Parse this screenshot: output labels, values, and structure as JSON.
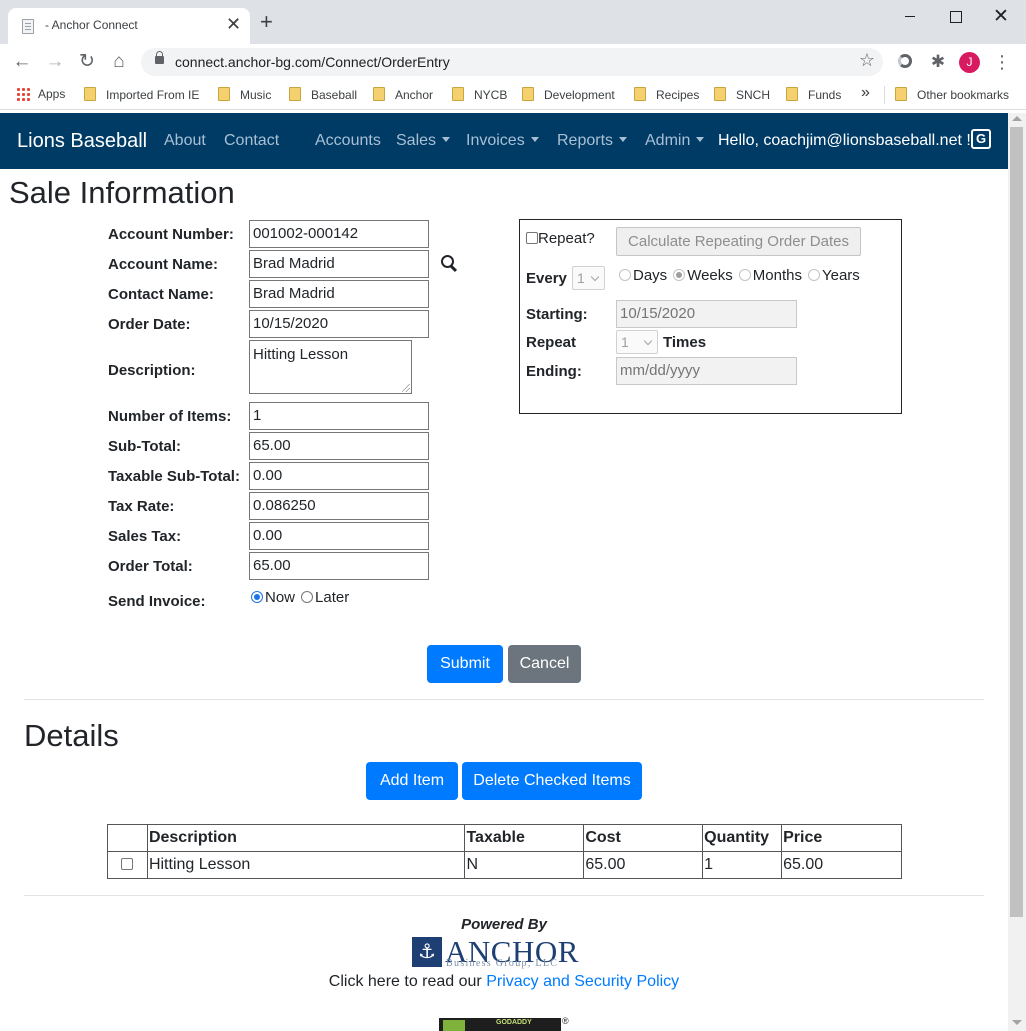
{
  "browser": {
    "tab_title": "- Anchor Connect",
    "url": "connect.anchor-bg.com/Connect/OrderEntry",
    "avatar_initial": "J",
    "bookmarks": [
      "Apps",
      "Imported From IE",
      "Music",
      "Baseball",
      "Anchor",
      "NYCB",
      "Development",
      "Recipes",
      "SNCH",
      "Funds"
    ],
    "other_bookmarks": "Other bookmarks"
  },
  "nav": {
    "brand": "Lions Baseball",
    "links": [
      "About",
      "Contact"
    ],
    "menus": [
      "Accounts",
      "Sales",
      "Invoices",
      "Reports",
      "Admin"
    ],
    "greeting": "Hello, coachjim@lionsbaseball.net !"
  },
  "sale": {
    "title": "Sale Information",
    "labels": {
      "account_number": "Account Number:",
      "account_name": "Account Name:",
      "contact_name": "Contact Name:",
      "order_date": "Order Date:",
      "description": "Description:",
      "number_of_items": "Number of Items:",
      "sub_total": "Sub-Total:",
      "taxable_sub_total": "Taxable Sub-Total:",
      "tax_rate": "Tax Rate:",
      "sales_tax": "Sales Tax:",
      "order_total": "Order Total:",
      "send_invoice": "Send Invoice:"
    },
    "values": {
      "account_number": "001002-000142",
      "account_name": "Brad Madrid",
      "contact_name": "Brad Madrid",
      "order_date": "10/15/2020",
      "description": "Hitting Lesson",
      "number_of_items": "1",
      "sub_total": "65.00",
      "taxable_sub_total": "0.00",
      "tax_rate": "0.086250",
      "sales_tax": "0.00",
      "order_total": "65.00"
    },
    "send_invoice_options": [
      "Now",
      "Later"
    ],
    "send_invoice_selected": "Now"
  },
  "repeat": {
    "repeat_label": "Repeat?",
    "calc_button": "Calculate Repeating Order Dates",
    "every_label": "Every",
    "every_value": "1",
    "periods": [
      "Days",
      "Weeks",
      "Months",
      "Years"
    ],
    "period_selected": "Weeks",
    "starting_label": "Starting:",
    "starting_value": "10/15/2020",
    "repeat_times_label": "Repeat",
    "repeat_times_value": "1",
    "times_label": "Times",
    "ending_label": "Ending:",
    "ending_placeholder": "mm/dd/yyyy"
  },
  "actions": {
    "submit": "Submit",
    "cancel": "Cancel"
  },
  "details": {
    "title": "Details",
    "add_item": "Add Item",
    "delete_checked": "Delete Checked Items",
    "columns": [
      "Description",
      "Taxable",
      "Cost",
      "Quantity",
      "Price"
    ],
    "rows": [
      {
        "description": "Hitting Lesson",
        "taxable": "N",
        "cost": "65.00",
        "quantity": "1",
        "price": "65.00"
      }
    ]
  },
  "footer": {
    "powered_by": "Powered By",
    "logo_word": "ANCHOR",
    "logo_sub": "Business Group, LLC",
    "privacy_prefix": "Click here to read our",
    "privacy_link": "Privacy and Security Policy",
    "badge_text": "GODADDY",
    "registered_mark": "®"
  }
}
